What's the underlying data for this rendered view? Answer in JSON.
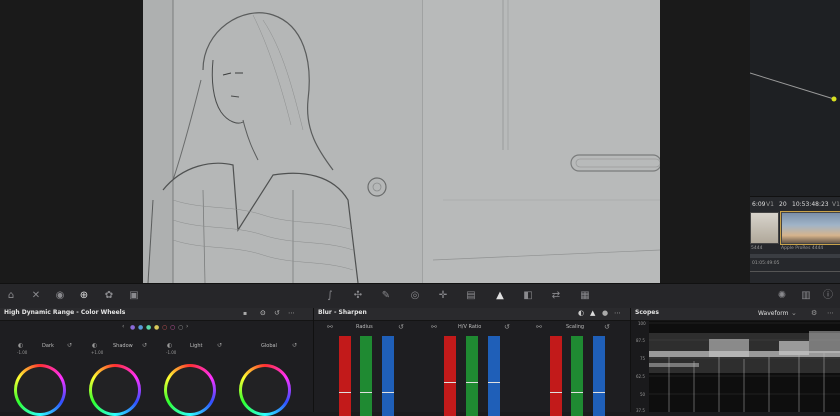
{
  "clip_strip": {
    "timecode_a": "6:09",
    "track_a": "V1",
    "clip_num_b": "20",
    "timecode_b": "10:53:48:23",
    "track_b": "V1",
    "clip_a_name": "5444",
    "clip_b_name": "Apple ProRes 4444",
    "timecode_c": "01:05:49:05"
  },
  "hdr_panel": {
    "title": "High Dynamic Range - Color Wheels",
    "wheels": [
      {
        "label": "Dark",
        "value": "-1.00"
      },
      {
        "label": "Shadow",
        "value": "+1.00"
      },
      {
        "label": "Light",
        "value": "-1.00"
      },
      {
        "label": "Global",
        "value": ""
      }
    ]
  },
  "blur_panel": {
    "title": "Blur - Sharpen",
    "groups": [
      {
        "label": "Radius"
      },
      {
        "label": "H/V Ratio"
      },
      {
        "label": "Scaling"
      }
    ],
    "colors": {
      "red": "#c21a1a",
      "green": "#1f8a32",
      "blue": "#1f5fb8"
    }
  },
  "scopes_panel": {
    "title": "Scopes",
    "mode": "Waveform",
    "scale": [
      "100",
      "87.5",
      "75",
      "62.5",
      "50",
      "37.5"
    ]
  },
  "toolbar": {
    "left_icons": [
      "camera-icon",
      "viewer-icon",
      "play-icon",
      "zoom-icon",
      "palette-icon",
      "thumbnail-icon"
    ],
    "center_icons": [
      "curves-icon",
      "warper-icon",
      "qualifier-icon",
      "window-icon",
      "tracker-icon",
      "magic-mask-icon",
      "blur-icon",
      "key-icon",
      "sizing-icon",
      "3d-icon"
    ],
    "right_icons": [
      "sparkle-icon",
      "scopes-icon",
      "info-icon"
    ]
  }
}
